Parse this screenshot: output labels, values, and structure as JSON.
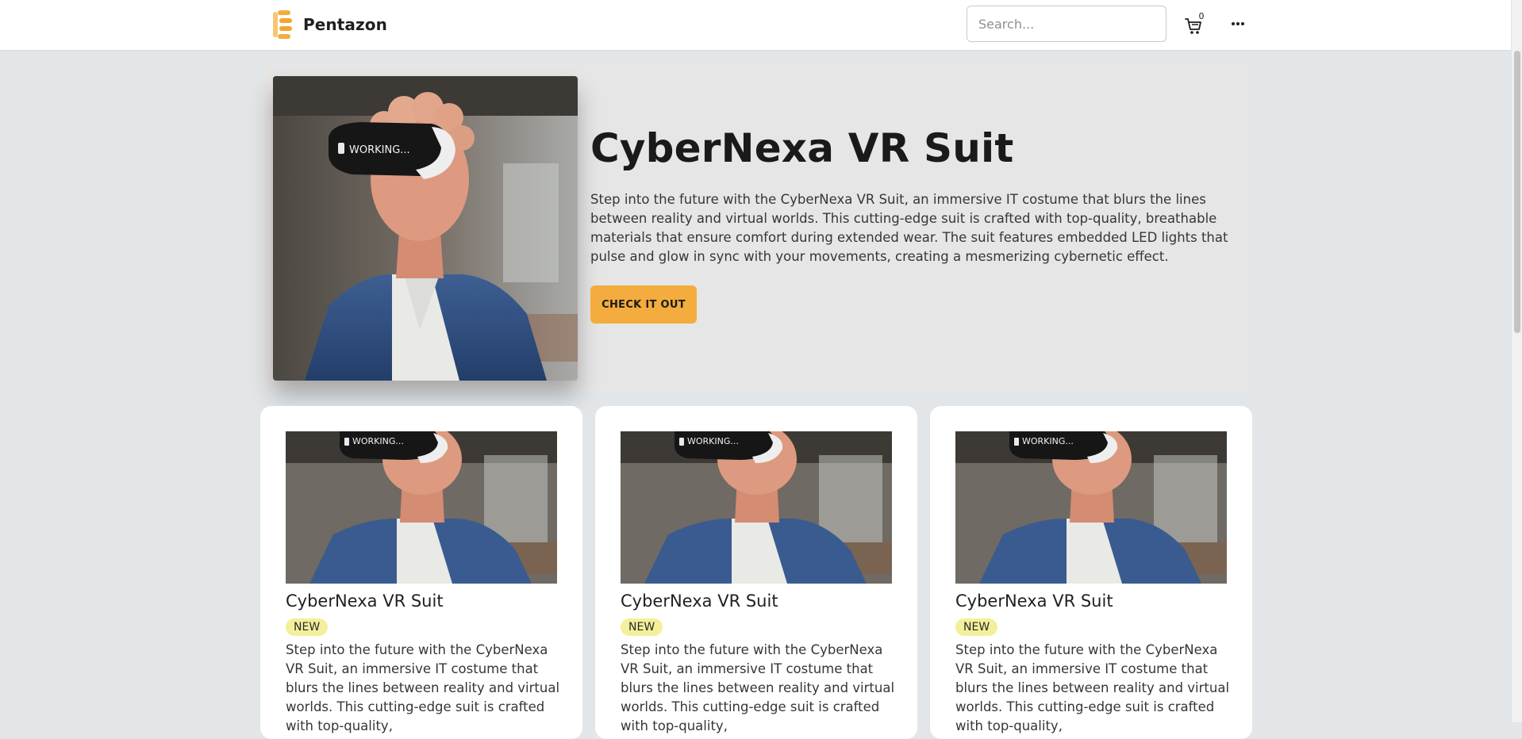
{
  "header": {
    "brand_name": "Pentazon",
    "logo_icon": "pentazon-logo-icon",
    "search_placeholder": "Search...",
    "cart_icon": "cart-icon",
    "cart_count": "0",
    "menu_icon": "more-horizontal-icon"
  },
  "hero": {
    "title": "CyberNexa VR Suit",
    "description": "Step into the future with the CyberNexa VR Suit, an immersive IT costume that blurs the lines between reality and virtual worlds. This cutting-edge suit is crafted with top-quality, breathable materials that ensure comfort during extended wear. The suit features embedded LED lights that pulse and glow in sync with your movements, creating a mesmerizing cybernetic effect.",
    "cta_label": "CHECK IT OUT",
    "image_overlay_text": "WORKING..."
  },
  "products": [
    {
      "title": "CyberNexa VR Suit",
      "badge": "NEW",
      "image_overlay_text": "WORKING...",
      "description": "Step into the future with the CyberNexa VR Suit, an immersive IT costume that blurs the lines between reality and virtual worlds. This cutting-edge suit is crafted with top-quality,"
    },
    {
      "title": "CyberNexa VR Suit",
      "badge": "NEW",
      "image_overlay_text": "WORKING...",
      "description": "Step into the future with the CyberNexa VR Suit, an immersive IT costume that blurs the lines between reality and virtual worlds. This cutting-edge suit is crafted with top-quality,"
    },
    {
      "title": "CyberNexa VR Suit",
      "badge": "NEW",
      "image_overlay_text": "WORKING...",
      "description": "Step into the future with the CyberNexa VR Suit, an immersive IT costume that blurs the lines between reality and virtual worlds. This cutting-edge suit is crafted with top-quality,"
    }
  ],
  "colors": {
    "accent": "#f3ac3d",
    "badge_bg": "#f4ef9a",
    "page_bg": "#e2e6e8",
    "hero_bg": "#e6e6e6"
  }
}
